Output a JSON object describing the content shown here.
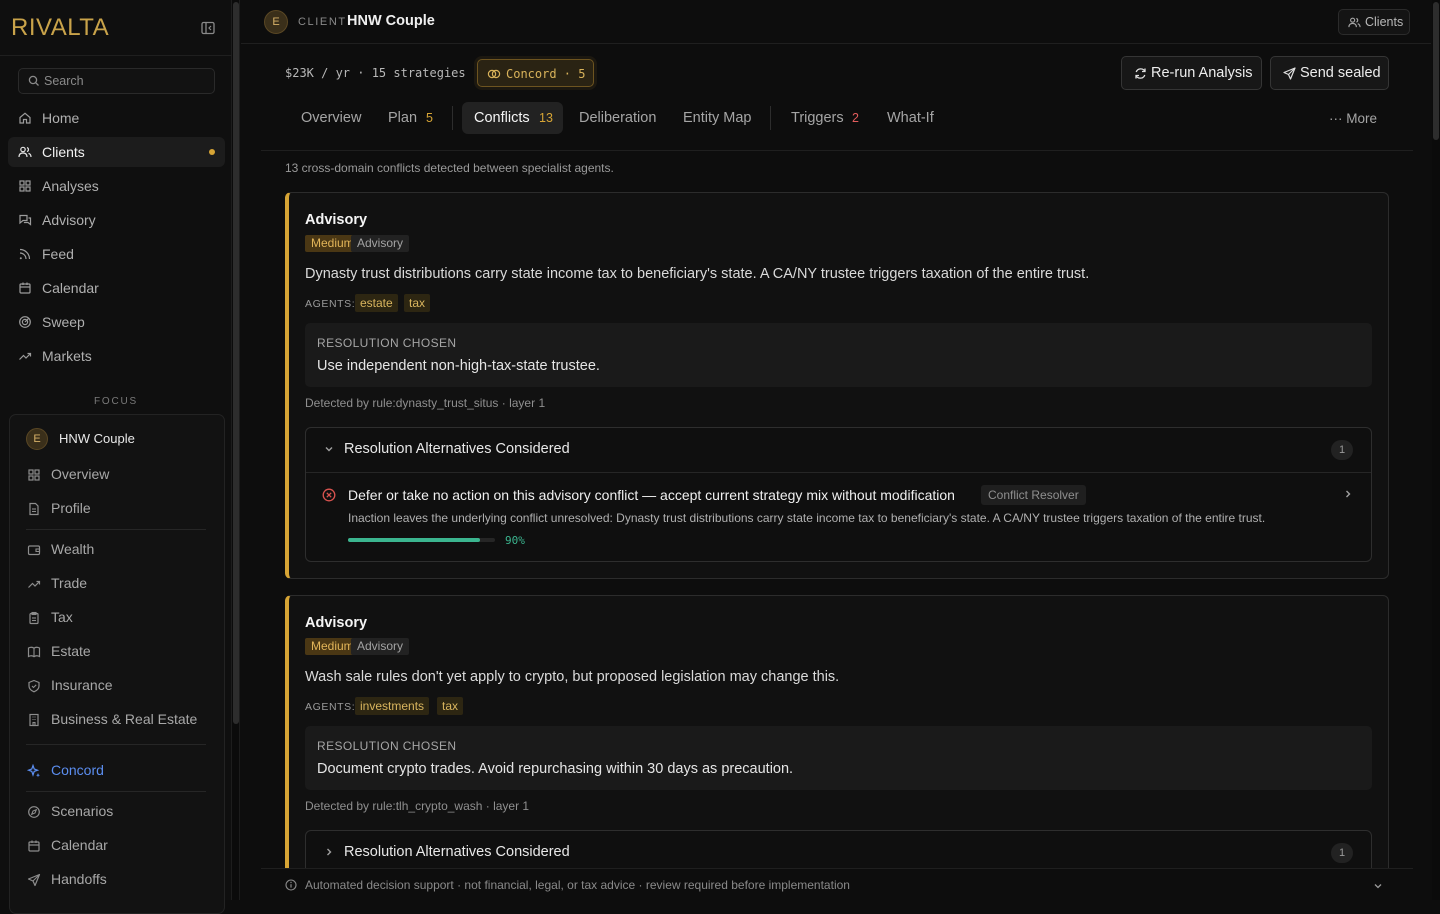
{
  "app": {
    "logo": "RIVALTA"
  },
  "sidebar": {
    "search_placeholder": "Search",
    "nav": [
      {
        "label": "Home",
        "icon": "home-icon"
      },
      {
        "label": "Clients",
        "icon": "users-icon",
        "active": true
      },
      {
        "label": "Analyses",
        "icon": "grid-icon"
      },
      {
        "label": "Advisory",
        "icon": "chat-icon"
      },
      {
        "label": "Feed",
        "icon": "rss-icon"
      },
      {
        "label": "Calendar",
        "icon": "calendar-icon"
      },
      {
        "label": "Sweep",
        "icon": "radar-icon"
      },
      {
        "label": "Markets",
        "icon": "trending-icon"
      }
    ],
    "focus_label": "FOCUS",
    "focus": {
      "avatar": "E",
      "client": "HNW Couple",
      "items": [
        {
          "label": "Overview"
        },
        {
          "label": "Profile"
        },
        {
          "label": "Wealth"
        },
        {
          "label": "Trade"
        },
        {
          "label": "Tax"
        },
        {
          "label": "Estate"
        },
        {
          "label": "Insurance"
        },
        {
          "label": "Business & Real Estate"
        },
        {
          "label": "Concord"
        },
        {
          "label": "Scenarios"
        },
        {
          "label": "Calendar"
        },
        {
          "label": "Handoffs"
        }
      ]
    }
  },
  "header": {
    "avatar": "E",
    "client_label": "CLIENT",
    "client_name": "HNW Couple",
    "clients_button": "Clients",
    "meta": "$23K / yr · 15 strategies",
    "concord_pill": "Concord · 5",
    "rerun_button": "Re-run Analysis",
    "send_button": "Send sealed"
  },
  "tabs": [
    {
      "label": "Overview",
      "count": ""
    },
    {
      "label": "Plan",
      "count": "5"
    },
    {
      "label": "Conflicts",
      "count": "13"
    },
    {
      "label": "Deliberation",
      "count": ""
    },
    {
      "label": "Entity Map",
      "count": ""
    },
    {
      "label": "Triggers",
      "count": "2"
    },
    {
      "label": "What-If",
      "count": ""
    }
  ],
  "more_label": "··· More",
  "subtitle": "13 cross-domain conflicts detected between specialist agents.",
  "conflicts": [
    {
      "title": "Advisory",
      "severity": "Medium",
      "category": "Advisory",
      "description": "Dynasty trust distributions carry state income tax to beneficiary's state. A CA/NY trustee triggers taxation of the entire trust.",
      "agents_label": "AGENTS:",
      "agents": [
        "estate",
        "tax"
      ],
      "resolution_heading": "RESOLUTION CHOSEN",
      "resolution": "Use independent non-high-tax-state trustee.",
      "detected": "Detected by rule:dynasty_trust_situs · layer 1",
      "alternatives_heading": "Resolution Alternatives Considered",
      "alternatives_count": "1",
      "alternative": {
        "title": "Defer or take no action on this advisory conflict — accept current strategy mix without modification",
        "tag": "Conflict Resolver",
        "description": "Inaction leaves the underlying conflict unresolved: Dynasty trust distributions carry state income tax to beneficiary's state. A CA/NY trustee triggers taxation of the entire trust.",
        "confidence": 0.9,
        "confidence_label": "90%"
      }
    },
    {
      "title": "Advisory",
      "severity": "Medium",
      "category": "Advisory",
      "description": "Wash sale rules don't yet apply to crypto, but proposed legislation may change this.",
      "agents_label": "AGENTS:",
      "agents": [
        "investments",
        "tax"
      ],
      "resolution_heading": "RESOLUTION CHOSEN",
      "resolution": "Document crypto trades. Avoid repurchasing within 30 days as precaution.",
      "detected": "Detected by rule:tlh_crypto_wash · layer 1",
      "alternatives_heading": "Resolution Alternatives Considered",
      "alternatives_count": "1"
    }
  ],
  "footer": "Automated decision support · not financial, legal, or tax advice · review required before implementation",
  "colors": {
    "accent": "#d6a435",
    "success": "#3bb58f",
    "error": "#d9534f",
    "link": "#5b8def"
  }
}
